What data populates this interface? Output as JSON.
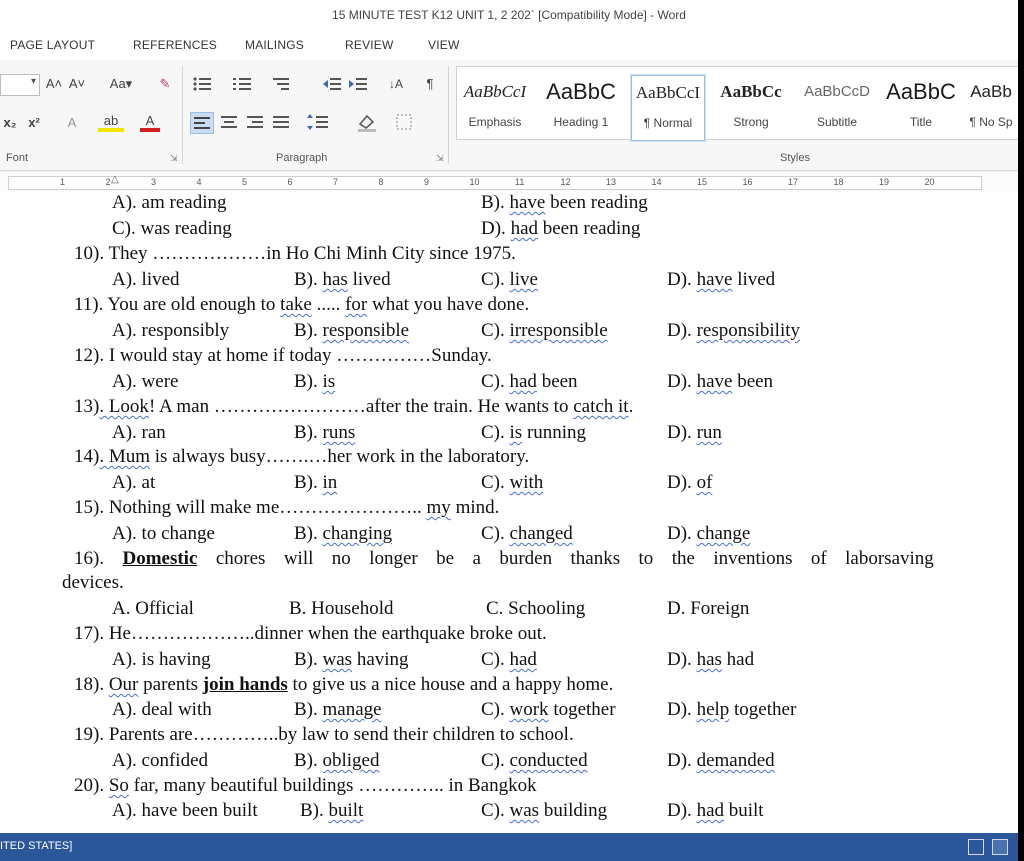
{
  "window": {
    "title": "15 MINUTE TEST K12 UNIT 1, 2 202` [Compatibility Mode] - Word"
  },
  "tabs": [
    "PAGE LAYOUT",
    "REFERENCES",
    "MAILINGS",
    "REVIEW",
    "VIEW"
  ],
  "ribbon": {
    "groups": {
      "font": "Font",
      "paragraph": "Paragraph",
      "styles": "Styles"
    },
    "font_buttons": {
      "grow": "A˄",
      "shrink": "A˅",
      "case": "Aa▾",
      "clear": "✎",
      "sub": "x₂",
      "sup": "x²",
      "effects": "A",
      "highlight": "ab",
      "color": "A"
    },
    "para_icons": {
      "pilcrow": "¶",
      "sort": "↓A"
    },
    "styles": [
      {
        "preview": "AaBbCcI",
        "name": "Emphasis"
      },
      {
        "preview": "AaBbC",
        "name": "Heading 1"
      },
      {
        "preview": "AaBbCcI",
        "name": "¶ Normal"
      },
      {
        "preview": "AaBbCc",
        "name": "Strong"
      },
      {
        "preview": "AaBbCcD",
        "name": "Subtitle"
      },
      {
        "preview": "AaBbC",
        "name": "Title"
      },
      {
        "preview": "AaBb",
        "name": "¶ No Sp"
      }
    ]
  },
  "ruler": {
    "numbers": [
      "1",
      "2",
      "3",
      "4",
      "5",
      "6",
      "7",
      "8",
      "9",
      "10",
      "11",
      "12",
      "13",
      "14",
      "15",
      "16",
      "17",
      "18",
      "19",
      "20"
    ]
  },
  "document": {
    "q9": {
      "a": "A). am reading",
      "b_pre": "B). ",
      "b_sq": "have",
      "b_post": " been reading",
      "c": "C). was reading",
      "d_pre": "D). ",
      "d_sq": "had",
      "d_post": " been reading"
    },
    "q10": {
      "stem": "10). They ………………in Ho Chi Minh City since 1975.",
      "a": "A). lived",
      "b_pre": "B). ",
      "b_sq": "has",
      "b_post": " lived",
      "c_pre": "C). ",
      "c_sq": "live",
      "d_pre": "D). ",
      "d_sq": "have",
      "d_post": " lived"
    },
    "q11": {
      "stem_pre": "11). You are old enough to ",
      "stem_sq1": "take",
      "stem_mid": " ..... ",
      "stem_sq2": "for",
      "stem_post": " what you have done.",
      "a": "A). responsibly",
      "b_pre": "B). ",
      "b_sq": "responsible",
      "c_pre": "C). ",
      "c_sq": "irresponsible",
      "d_pre": "D). ",
      "d_sq": "responsibility"
    },
    "q12": {
      "stem": "12). I would stay at home if today ……………Sunday.",
      "a": "A). were",
      "b_pre": "B). ",
      "b_sq": "is",
      "c_pre": "C). ",
      "c_sq": "had",
      "c_post": " been",
      "d_pre": "D). ",
      "d_sq": "have",
      "d_post": " been"
    },
    "q13": {
      "stem_pre": "13)",
      "stem_sq": ". Look",
      "stem_mid": "! A man ……………………after the train. He wants to ",
      "stem_sq2": "catch  it",
      "stem_post": ".",
      "a": "A). ran",
      "b_pre": "B). ",
      "b_sq": "runs",
      "c_pre": "C). ",
      "c_sq": "is",
      "c_post": " running",
      "d_pre": "D). ",
      "d_sq": "run"
    },
    "q14": {
      "stem_pre": "14)",
      "stem_sq": ". Mum",
      "stem_post": " is always busy…….…her work in the laboratory.",
      "a": "A). at",
      "b_pre": "B). ",
      "b_sq": "in",
      "c_pre": "C). ",
      "c_sq": "with",
      "d_pre": "D). ",
      "d_sq": "of"
    },
    "q15": {
      "stem_pre": "15). Nothing will make me………………….. ",
      "stem_sq": "my",
      "stem_post": " mind.",
      "a": "A). to change",
      "b_pre": "B). ",
      "b_sq": "changing",
      "c_pre": "C). ",
      "c_sq": "changed",
      "d_pre": "D). ",
      "d_sq": "change"
    },
    "q16": {
      "num": "16).",
      "bold": "Domestic",
      "rest": "chores will no longer be a burden thanks to the inventions of laborsaving",
      "cont": "devices.",
      "a": "A. Official",
      "b": "B. Household",
      "c": "C. Schooling",
      "d": "D. Foreign"
    },
    "q17": {
      "stem": "17). He………………..dinner when the earthquake broke out.",
      "a": "A). is having",
      "b_pre": "B). ",
      "b_sq": "was",
      "b_post": " having",
      "c_pre": "C). ",
      "c_sq": "had",
      "d_pre": "D). ",
      "d_sq": "has",
      "d_post": " had"
    },
    "q18": {
      "stem_pre": "18). ",
      "stem_sq": "Our",
      "stem_mid": " parents ",
      "stem_bold": "join hands",
      "stem_post": " to give us a nice house and a happy home.",
      "a": "A). deal with",
      "b_pre": "B). ",
      "b_sq": "manage",
      "c_pre": "C). ",
      "c_sq": "work",
      "c_post": " together",
      "d_pre": "D). ",
      "d_sq": "help",
      "d_post": " together"
    },
    "q19": {
      "stem": "19). Parents are…………..by law to send their children to school.",
      "a": "A). confided",
      "b_pre": "B). ",
      "b_sq": "obliged",
      "c_pre": "C). ",
      "c_sq": "conducted",
      "d_pre": "D). ",
      "d_sq": "demanded"
    },
    "q20": {
      "stem_pre": "20). ",
      "stem_sq": "So",
      "stem_post": " far, many beautiful buildings ………….. in Bangkok",
      "a": "A). have been built",
      "b_pre": "B). ",
      "b_sq": "built",
      "c_pre": "C). ",
      "c_sq": "was",
      "c_post": " building",
      "d_pre": "D). ",
      "d_sq": "had",
      "d_post": " built"
    }
  },
  "statusbar": {
    "language": "ITED STATES]"
  },
  "colors": {
    "status_bg": "#2b579a",
    "squiggle": "#4a6fd0",
    "accent": "#2b579a"
  }
}
